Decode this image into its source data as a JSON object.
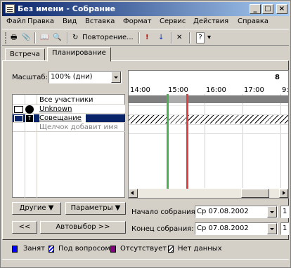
{
  "window": {
    "title": "Без имени - Собрание"
  },
  "menu": [
    "Файл",
    "Правка",
    "Вид",
    "Вставка",
    "Формат",
    "Сервис",
    "Действия",
    "Справка"
  ],
  "toolbar": {
    "recurrence_label": "Повторение..."
  },
  "tabs": [
    {
      "label": "Встреча",
      "active": false
    },
    {
      "label": "Планирование",
      "active": true
    }
  ],
  "scale": {
    "label": "Масштаб:",
    "value": "100% (дни)"
  },
  "date_header": "8",
  "attendees": {
    "header": "Все участники",
    "rows": [
      {
        "name": "Unknown"
      },
      {
        "name": "Совещание"
      },
      {
        "name": "Щелчок добавит имя"
      }
    ]
  },
  "timeline": {
    "ticks": [
      "14:00",
      "15:00",
      "16:00",
      "17:00",
      "9:"
    ]
  },
  "buttons": {
    "others": "Другие",
    "options": "Параметры",
    "prev": "<<",
    "autoselect": "Автовыбор >>"
  },
  "meeting": {
    "start_label": "Начало собрания:",
    "start_date": "Ср 07.08.2002",
    "end_label": "Конец собрания:",
    "end_date": "Ср 07.08.2002",
    "time_fragment": "1"
  },
  "legend": {
    "busy": "Занят",
    "tentative": "Под вопросом",
    "out": "Отсутствует",
    "nodata": "Нет данных",
    "colors": {
      "busy": "#0000ff",
      "tentative": "#0000ff",
      "out": "#800080"
    }
  }
}
